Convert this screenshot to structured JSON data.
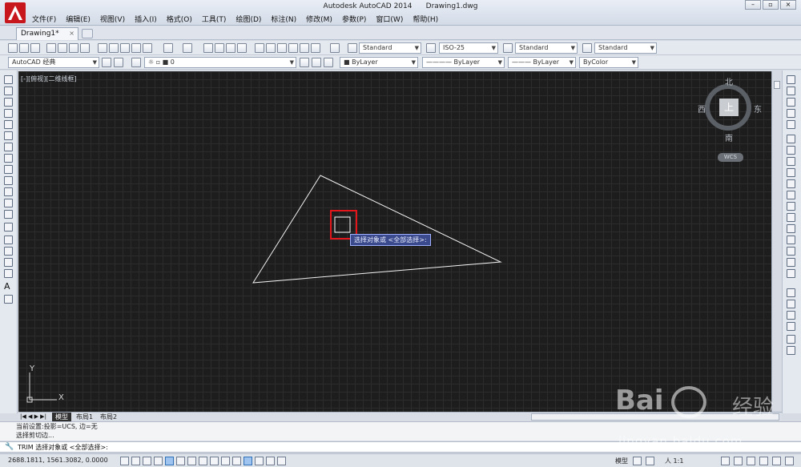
{
  "window": {
    "app_title": "Autodesk AutoCAD 2014",
    "doc_title": "Drawing1.dwg"
  },
  "menu": [
    "文件(F)",
    "编辑(E)",
    "视图(V)",
    "插入(I)",
    "格式(O)",
    "工具(T)",
    "绘图(D)",
    "标注(N)",
    "修改(M)",
    "参数(P)",
    "窗口(W)",
    "帮助(H)"
  ],
  "tabs": {
    "doc_tab": "Drawing1*",
    "close_glyph": "×"
  },
  "toolbar1": {
    "text_style": "Standard",
    "dim_style": "ISO-25",
    "table_style": "Standard",
    "mleader_style": "Standard"
  },
  "toolbar2": {
    "workspace": "AutoCAD 经典",
    "layer": "0",
    "color": "ByLayer",
    "linetype": "ByLayer",
    "lineweight": "ByLayer",
    "plot_style": "ByColor"
  },
  "viewport": {
    "label": "[-][俯视][二维线框]",
    "compass": {
      "north": "北",
      "south": "南",
      "east": "东",
      "west": "西",
      "face": "上",
      "wcs": "WCS"
    },
    "tooltip": "选择对象或 <全部选择>:",
    "ucs_x": "X",
    "ucs_y": "Y"
  },
  "layout_tabs": [
    "模型",
    "布局1",
    "布局2"
  ],
  "command": {
    "history": [
      "当前设置:投影=UCS, 边=无",
      "选择剪切边..."
    ],
    "prompt": "TRIM 选择对象或 <全部选择>:"
  },
  "status": {
    "coordinates": "2688.1811, 1561.3082, 0.0000",
    "model": "模型",
    "scale": "人 1:1"
  },
  "watermark": {
    "brand": "Bai",
    "brand2": "经验",
    "url": "jingyan.baidu.com"
  },
  "colors": {
    "canvas_bg": "#1d1d1d",
    "highlight": "#e3161b",
    "tooltip_bg": "#3a4a8c",
    "logo_red": "#c8161d"
  }
}
